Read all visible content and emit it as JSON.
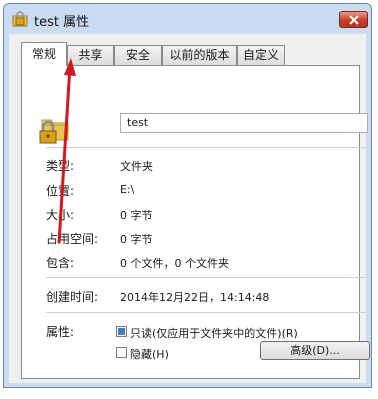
{
  "window": {
    "title": "test 属性",
    "icons": {
      "title": "lock-folder-icon",
      "close": "close-icon"
    },
    "colors": {
      "accent": "#3d7fc1",
      "arrow": "#d01820",
      "close": "#c8402b"
    }
  },
  "tabs": [
    {
      "label": "常规",
      "active": true
    },
    {
      "label": "共享",
      "active": false
    },
    {
      "label": "安全",
      "active": false
    },
    {
      "label": "以前的版本",
      "active": false
    },
    {
      "label": "自定义",
      "active": false
    }
  ],
  "general": {
    "name_value": "test",
    "rows": [
      {
        "label": "类型:",
        "value": "文件夹"
      },
      {
        "label": "位置:",
        "value": "E:\\"
      },
      {
        "label": "大小:",
        "value": "0 字节"
      },
      {
        "label": "占用空间:",
        "value": "0 字节"
      },
      {
        "label": "包含:",
        "value": "0 个文件，0 个文件夹"
      }
    ],
    "created": {
      "label": "创建时间:",
      "value": "2014年12月22日，14:14:48"
    },
    "attributes": {
      "label": "属性:",
      "readonly": {
        "label": "只读(仅应用于文件夹中的文件)(R)",
        "checked": true
      },
      "hidden": {
        "label": "隐藏(H)",
        "checked": false
      },
      "advanced_button": "高级(D)..."
    }
  }
}
